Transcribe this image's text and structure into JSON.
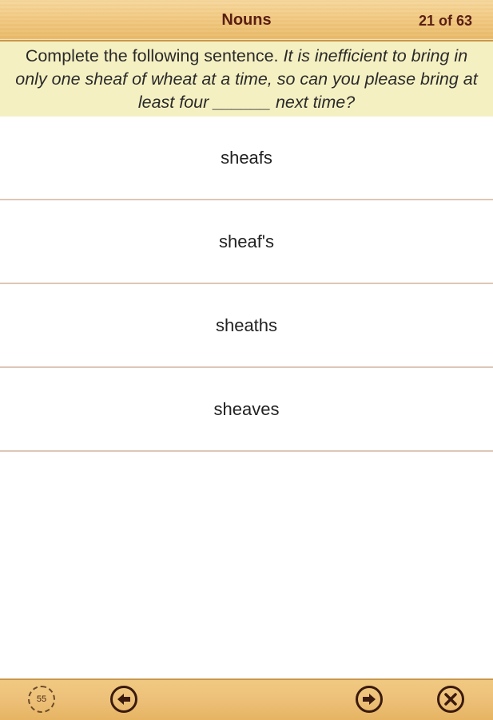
{
  "header": {
    "title": "Nouns",
    "counter": "21 of 63"
  },
  "question": {
    "lead": "Complete the following sentence.",
    "body": "It is inefficient to bring in only one sheaf of wheat at a time, so can you please bring at least four ______ next time?"
  },
  "answers": [
    {
      "label": "sheafs"
    },
    {
      "label": "sheaf's"
    },
    {
      "label": "sheaths"
    },
    {
      "label": "sheaves"
    }
  ],
  "toolbar": {
    "timer_value": "55",
    "icons": {
      "timer": "timer-icon",
      "back": "arrow-left-icon",
      "next": "arrow-right-icon",
      "close": "close-icon"
    }
  },
  "colors": {
    "bar": "#f1c981",
    "question_bg": "#f4f0c2",
    "title_text": "#5a1e12",
    "divider": "#ddc7b6"
  }
}
